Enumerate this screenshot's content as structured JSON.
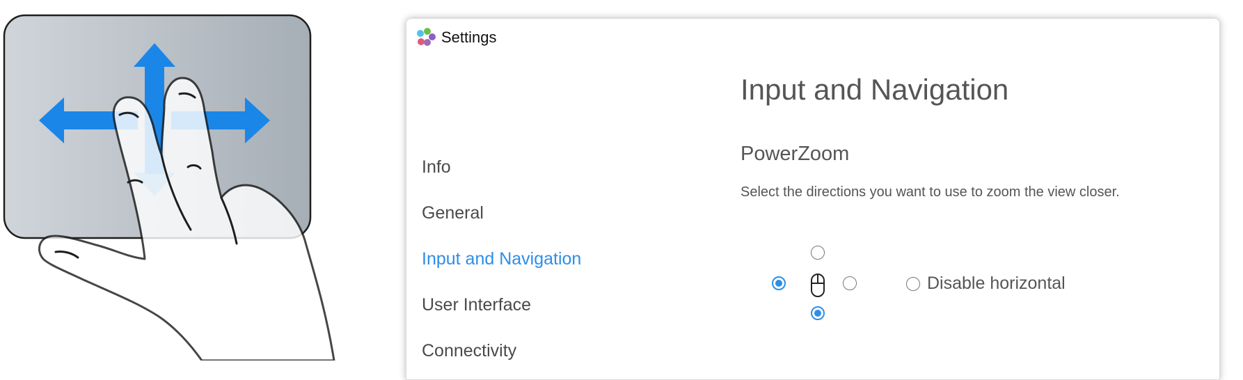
{
  "window": {
    "title": "Settings"
  },
  "sidebar": {
    "items": [
      {
        "label": "Info",
        "active": false
      },
      {
        "label": "General",
        "active": false
      },
      {
        "label": "Input and Navigation",
        "active": true
      },
      {
        "label": "User Interface",
        "active": false
      },
      {
        "label": "Connectivity",
        "active": false
      }
    ]
  },
  "main": {
    "page_title": "Input and Navigation",
    "section_title": "PowerZoom",
    "section_desc": "Select the directions you want to use to zoom the view closer.",
    "directions": {
      "up": false,
      "left": true,
      "right": false,
      "down": true
    },
    "disable_horizontal": {
      "label": "Disable horizontal",
      "checked": false
    }
  },
  "colors": {
    "accent": "#2d8ee8",
    "arrow": "#1a86e8",
    "trackpad": "#b4bcc4"
  },
  "icons": [
    "settings-logo-icon",
    "mouse-icon",
    "trackpad-gesture-illustration"
  ]
}
